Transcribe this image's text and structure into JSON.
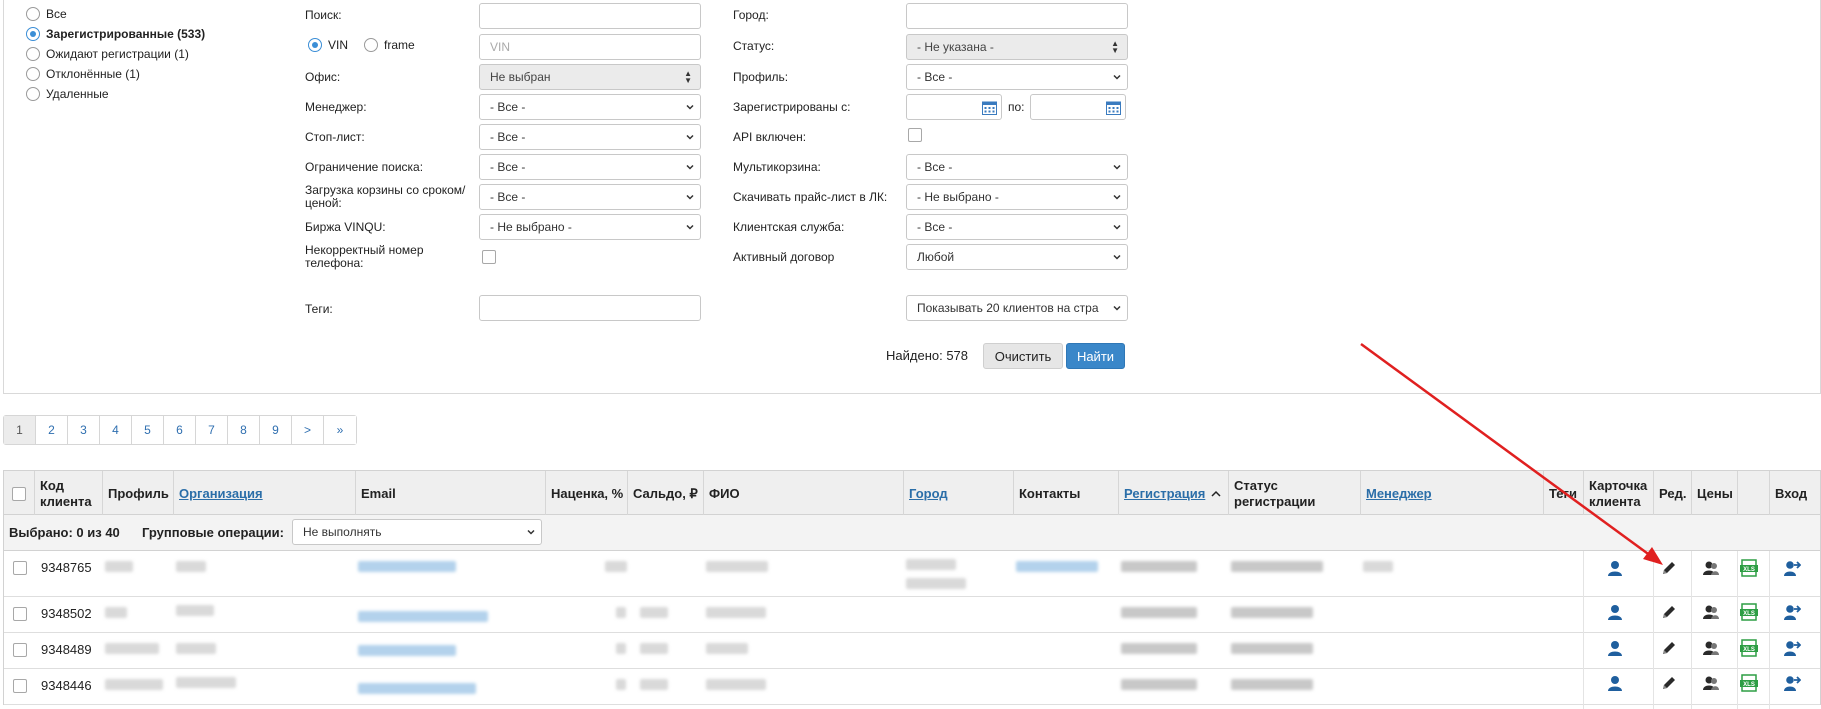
{
  "status_filter": {
    "items": [
      {
        "label": "Все",
        "checked": false,
        "bold": false
      },
      {
        "label": "Зарегистрированные (533)",
        "checked": true,
        "bold": true
      },
      {
        "label": "Ожидают регистрации (1)",
        "checked": false,
        "bold": false
      },
      {
        "label": "Отклонённые (1)",
        "checked": false,
        "bold": false
      },
      {
        "label": "Удаленные",
        "checked": false,
        "bold": false
      }
    ]
  },
  "filters": {
    "search_label": "Поиск:",
    "vin_label": "VIN",
    "frame_label": "frame",
    "vin_placeholder": "VIN",
    "office_label": "Офис:",
    "office_value": "Не выбран",
    "manager_label": "Менеджер:",
    "manager_value": "- Все -",
    "stoplist_label": "Стоп-лист:",
    "stoplist_value": "- Все -",
    "search_limit_label": "Ограничение поиска:",
    "search_limit_value": "- Все -",
    "cart_upload_label": "Загрузка корзины со сроком/ ценой:",
    "cart_upload_value": "- Все -",
    "vinqu_label": "Биржа VINQU:",
    "vinqu_value": "- Не выбрано -",
    "bad_phone_label": "Некорректный номер телефона:",
    "tags_label": "Теги:",
    "city_label": "Город:",
    "status_label": "Статус:",
    "status_value": "- Не указана -",
    "profile_label": "Профиль:",
    "profile_value": "- Все -",
    "registered_from_label": "Зарегистрированы с:",
    "registered_to_label": "по:",
    "api_label": "API включен:",
    "multicart_label": "Мультикорзина:",
    "multicart_value": "- Все -",
    "pricelist_label": "Скачивать прайс-лист в ЛК:",
    "pricelist_value": "- Не выбрано -",
    "client_service_label": "Клиентская служба:",
    "client_service_value": "- Все -",
    "contract_label": "Активный договор",
    "contract_value": "Любой",
    "per_page_value": "Показывать 20 клиентов на стра",
    "found_text": "Найдено: 578",
    "clear_label": "Очистить",
    "find_label": "Найти"
  },
  "pagination": [
    "1",
    "2",
    "3",
    "4",
    "5",
    "6",
    "7",
    "8",
    "9",
    ">",
    "»"
  ],
  "table": {
    "headers": {
      "code": "Код клиента",
      "profile": "Профиль",
      "organization": "Организация",
      "email": "Email",
      "markup": "Наценка, %",
      "balance": "Сальдо, ₽",
      "fio": "ФИО",
      "city": "Город",
      "contacts": "Контакты",
      "registration": "Регистрация",
      "reg_status": "Статус регистрации",
      "manager": "Менеджер",
      "tags": "Теги",
      "card": "Карточка клиента",
      "edit": "Ред.",
      "prices": "Цены",
      "login": "Вход"
    },
    "selected_text": "Выбрано: 0 из 40",
    "group_ops_label": "Групповые операции:",
    "group_ops_value": "Не выполнять",
    "rows": [
      {
        "code": "9348765"
      },
      {
        "code": "9348502"
      },
      {
        "code": "9348489"
      },
      {
        "code": "9348446"
      }
    ]
  },
  "colors": {
    "accent": "#3a87c9",
    "link": "#2b6ea8",
    "icon_blue": "#1f5f9e",
    "annotation_arrow": "#e02020"
  }
}
